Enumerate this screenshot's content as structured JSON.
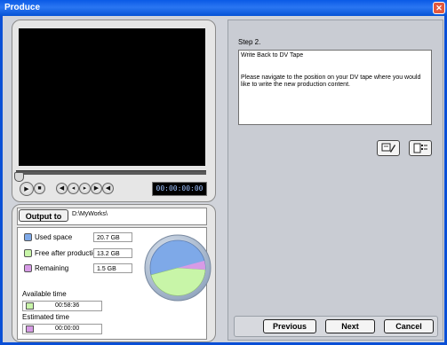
{
  "window": {
    "title": "Produce"
  },
  "player": {
    "timecode": "00:00:00:00"
  },
  "output": {
    "button_label": "Output to",
    "path": "D:\\MyWorks\\"
  },
  "stats": {
    "used_label": "Used space",
    "used_value": "20.7  GB",
    "free_label": "Free after production",
    "free_value": "13.2  GB",
    "remaining_label": "Remaining",
    "remaining_value": "1.5  GB",
    "available_time_label": "Available time",
    "available_time_value": "00:58:36",
    "estimated_time_label": "Estimated time",
    "estimated_time_value": "00:00:00"
  },
  "colors": {
    "used": "#7ea9e8",
    "free": "#c8f5a8",
    "remaining": "#d79be6",
    "titlebar": "#0a5ae6"
  },
  "wizard": {
    "step_label": "Step 2.",
    "title": "Write Back to DV Tape",
    "description": "Please navigate to the position on your DV tape where you would like to write the new production content."
  },
  "icons": [
    "close-icon",
    "play-icon",
    "stop-icon",
    "prev-frame-icon",
    "step-back-icon",
    "step-forward-icon",
    "next-frame-icon",
    "volume-icon",
    "tape-settings-icon",
    "properties-icon"
  ],
  "buttons": {
    "previous": "Previous",
    "next": "Next",
    "cancel": "Cancel"
  }
}
